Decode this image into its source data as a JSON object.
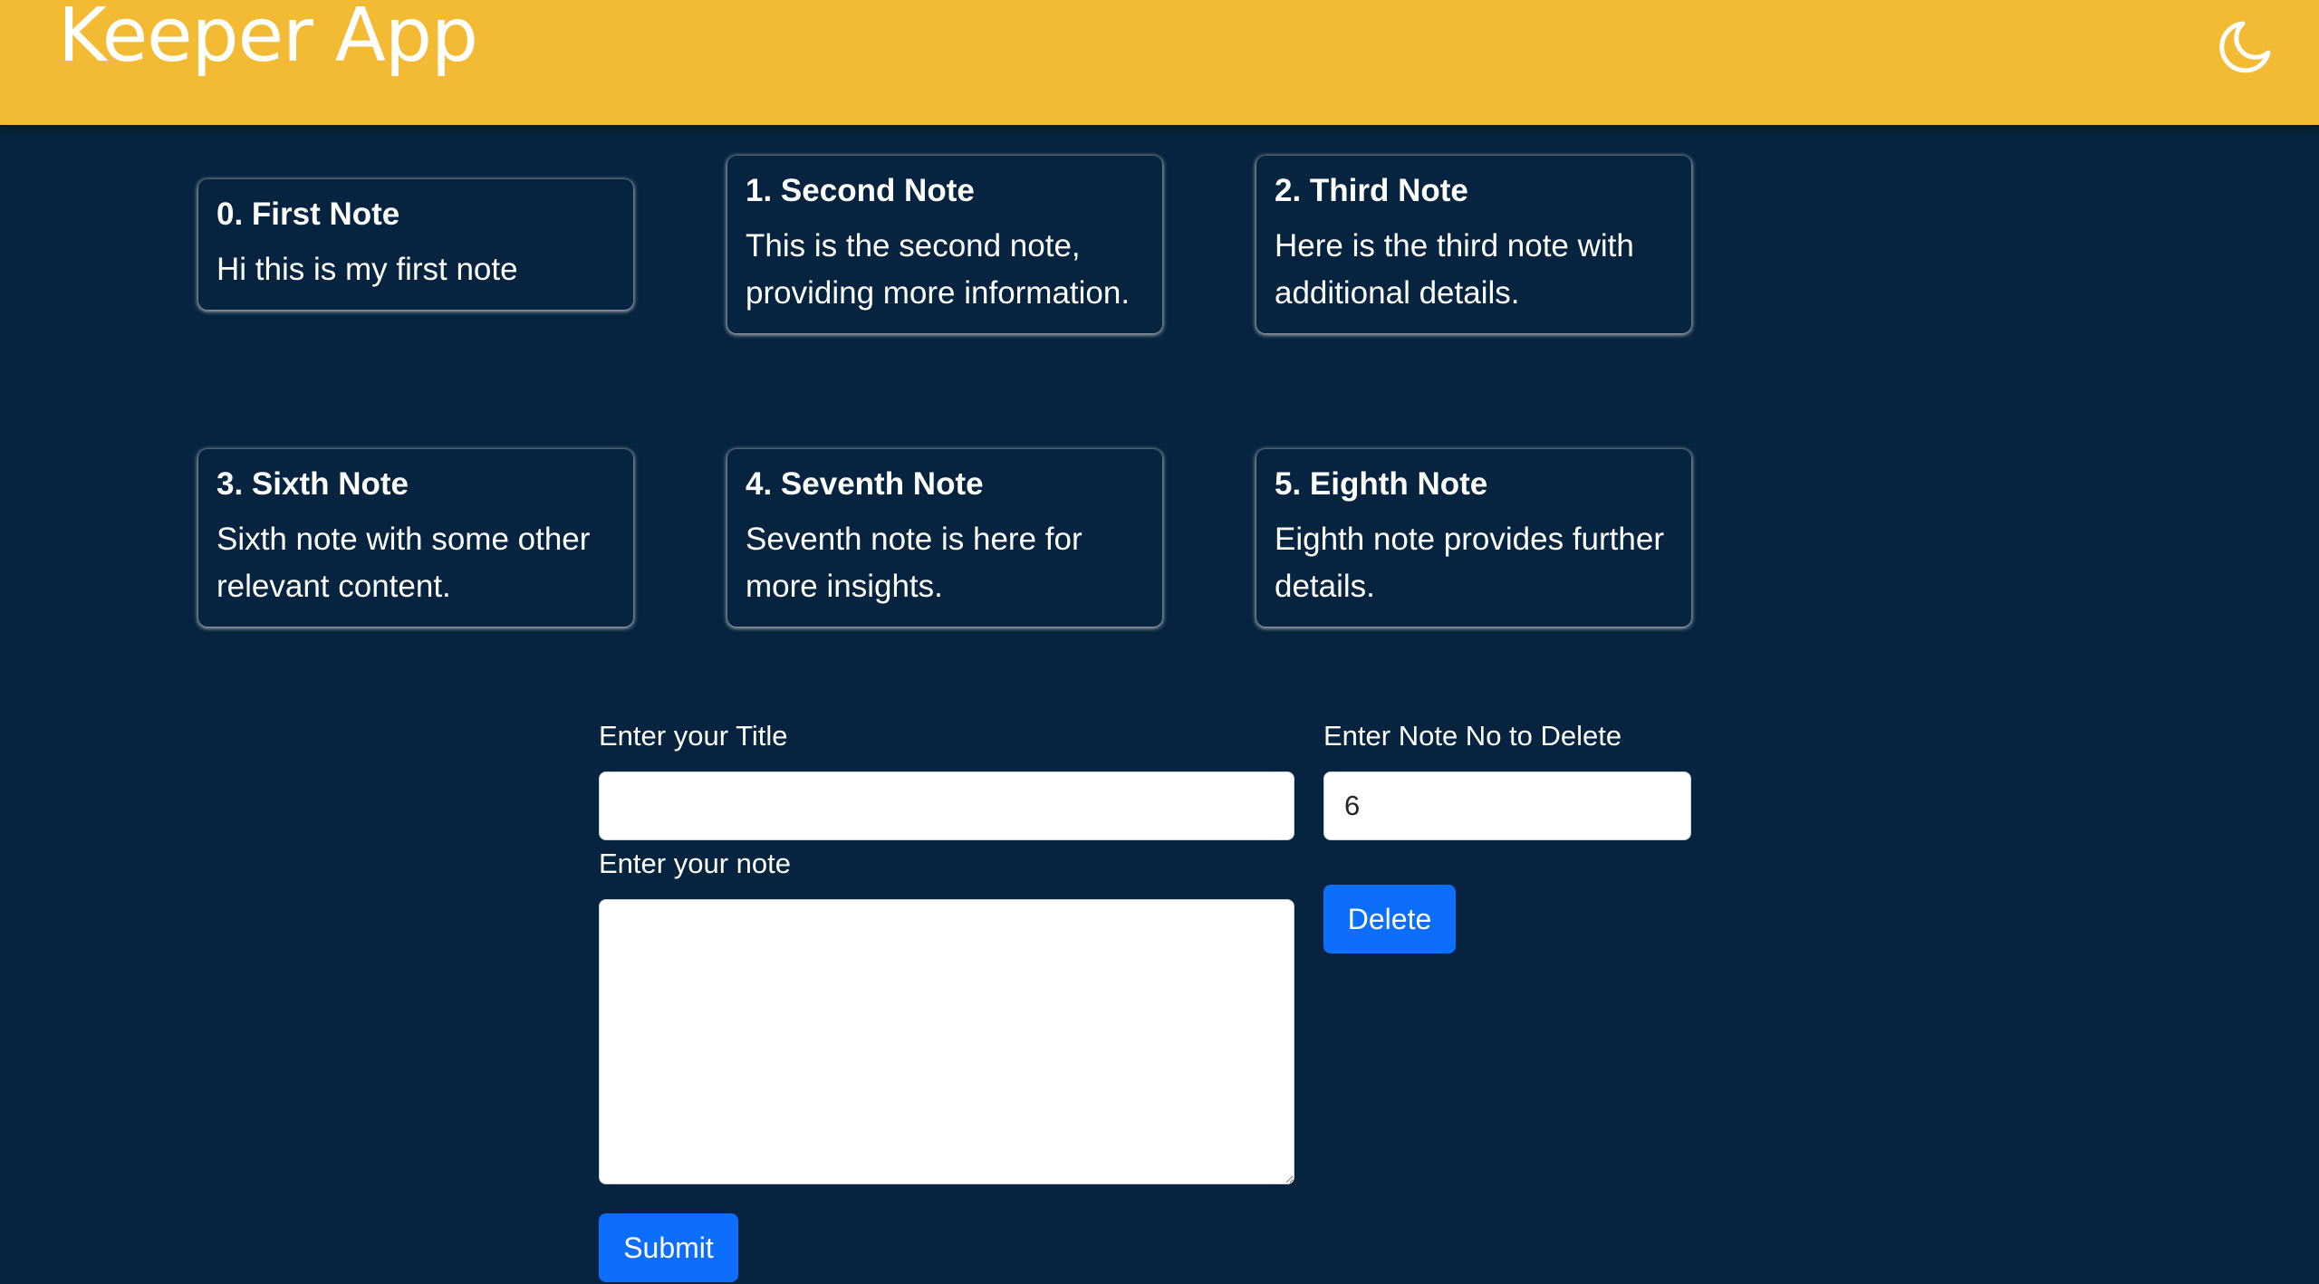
{
  "header": {
    "title": "Keeper App",
    "theme_icon": "moon-icon",
    "background": "#f3ba34"
  },
  "notes": [
    {
      "title": "0. First Note",
      "content": "Hi this is my first note"
    },
    {
      "title": "1. Second Note",
      "content": "This is the second note, providing more information."
    },
    {
      "title": "2. Third Note",
      "content": "Here is the third note with additional details."
    },
    {
      "title": "3. Sixth Note",
      "content": "Sixth note with some other relevant content."
    },
    {
      "title": "4. Seventh Note",
      "content": "Seventh note is here for more insights."
    },
    {
      "title": "5. Eighth Note",
      "content": "Eighth note provides further details."
    }
  ],
  "form": {
    "title_label": "Enter your Title",
    "title_value": "",
    "note_label": "Enter your note",
    "note_value": "",
    "submit_label": "Submit"
  },
  "delete": {
    "label": "Enter Note No to Delete",
    "value": "6",
    "button_label": "Delete"
  },
  "colors": {
    "page_background": "#06243f",
    "accent": "#f3ba34",
    "button": "#0d6efd"
  }
}
